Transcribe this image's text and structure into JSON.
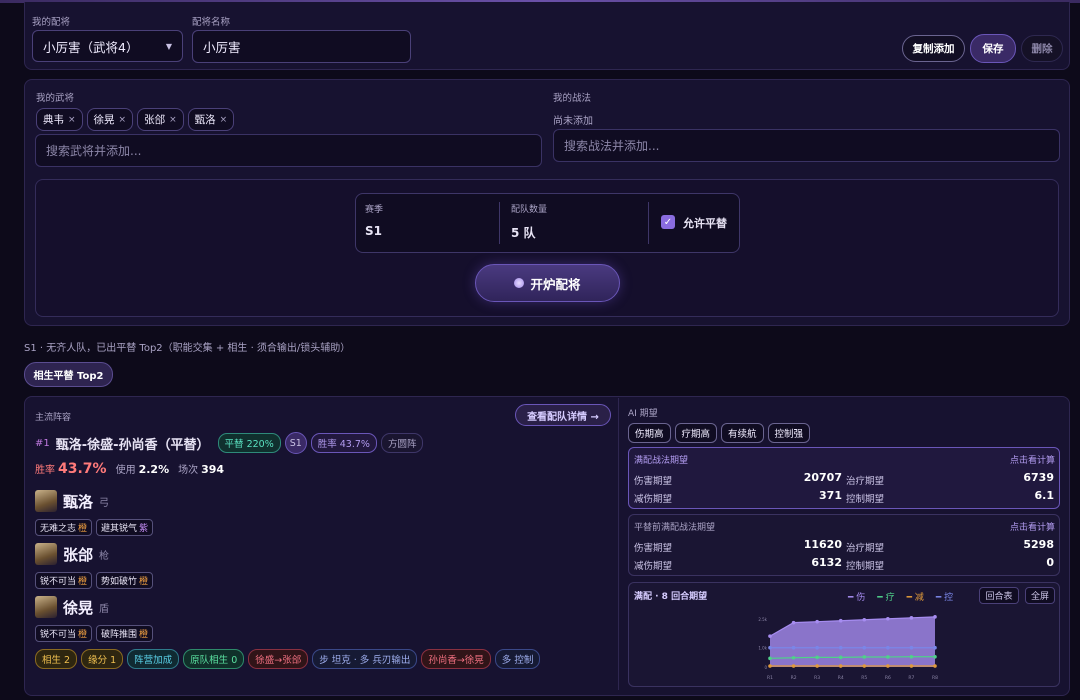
{
  "config": {
    "my_config_label": "我的配将",
    "my_config_value": "小厉害（武将4）",
    "name_label": "配将名称",
    "name_value": "小厉害",
    "copy_btn": "复制添加",
    "save_btn": "保存",
    "delete_btn": "删除"
  },
  "heroes": {
    "label": "我的武将",
    "chips": [
      "典韦",
      "徐晃",
      "张郃",
      "甄洛"
    ],
    "placeholder": "搜索武将并添加..."
  },
  "tactics": {
    "label": "我的战法",
    "empty": "尚未添加",
    "placeholder": "搜索战法并添加..."
  },
  "options": {
    "season_label": "赛季",
    "season_value": "S1",
    "team_label": "配队数量",
    "team_value": "5 队",
    "allow_sub_label": "允许平替",
    "forge_btn": "开炉配将"
  },
  "summary": "S1 · 无齐人队，已出平替 Top2（职能交集 + 相生 · 须合输出/锁头辅助）",
  "tab_label": "相生平替 Top2",
  "lineup": {
    "section_label": "主流阵容",
    "detail_btn": "查看配队详情 →",
    "rank": "#1",
    "title": "甄洛-徐盛-孙尚香（平替）",
    "sub_badge": "平替 220%",
    "season_badge": "S1",
    "winrate_badge": "胜率 43.7%",
    "formation_badge": "方圆阵",
    "winrate_label": "胜率",
    "winrate_value": "43.7%",
    "usage_label": "使用",
    "usage_value": "2.2%",
    "games_label": "场次",
    "games_value": "394",
    "generals": [
      {
        "name": "甄洛",
        "type": "弓",
        "skills": [
          {
            "name": "无难之志",
            "grade": "橙"
          },
          {
            "name": "避其锐气",
            "grade": "紫"
          }
        ]
      },
      {
        "name": "张郃",
        "type": "枪",
        "skills": [
          {
            "name": "锐不可当",
            "grade": "橙"
          },
          {
            "name": "势如破竹",
            "grade": "橙"
          }
        ]
      },
      {
        "name": "徐晃",
        "type": "盾",
        "skills": [
          {
            "name": "锐不可当",
            "grade": "橙"
          },
          {
            "name": "破阵推围",
            "grade": "橙"
          }
        ]
      }
    ],
    "tags": [
      "相生 2",
      "缘分 1",
      "阵营加成",
      "原队相生 0",
      "徐盛→张郃",
      "步 坦克 · 多 兵刃输出",
      "孙尚香→徐晃",
      "多 控制"
    ]
  },
  "ai": {
    "label": "AI 期望",
    "chips": [
      "伤期高",
      "疗期高",
      "有续航",
      "控制强"
    ],
    "full": {
      "title": "满配战法期望",
      "link": "点击看计算",
      "dmg_label": "伤害期望",
      "dmg": "20707",
      "heal_label": "治疗期望",
      "heal": "6739",
      "red_label": "减伤期望",
      "red": "371",
      "ctrl_label": "控制期望",
      "ctrl": "6.1"
    },
    "sub": {
      "title": "平替前满配战法期望",
      "link": "点击看计算",
      "dmg_label": "伤害期望",
      "dmg": "11620",
      "heal_label": "治疗期望",
      "heal": "5298",
      "red_label": "减伤期望",
      "red": "6132",
      "ctrl_label": "控制期望",
      "ctrl": "0"
    },
    "chart_title": "满配 · 8 回合期望",
    "legend": [
      "伤",
      "疗",
      "减",
      "控"
    ],
    "table_btn": "回合表",
    "full_btn": "全屏"
  },
  "colors": {
    "dmg": "#a68cf0",
    "heal": "#4fd08a",
    "red": "#e09a3a",
    "ctrl": "#7a86e8"
  },
  "chart_data": {
    "type": "line",
    "x": [
      "R1",
      "R2",
      "R3",
      "R4",
      "R5",
      "R6",
      "R7",
      "R8"
    ],
    "ytick_labels": [
      "2.5k",
      "1.0k",
      "0"
    ],
    "series": [
      {
        "name": "伤",
        "values": [
          1.6,
          2.3,
          2.35,
          2.4,
          2.45,
          2.5,
          2.55,
          2.6
        ]
      },
      {
        "name": "疗",
        "values": [
          0.45,
          0.48,
          0.5,
          0.5,
          0.52,
          0.52,
          0.53,
          0.53
        ]
      },
      {
        "name": "减",
        "values": [
          0.05,
          0.05,
          0.05,
          0.05,
          0.05,
          0.05,
          0.05,
          0.05
        ]
      },
      {
        "name": "控",
        "values": [
          1.0,
          1.0,
          1.0,
          1.0,
          1.0,
          1.0,
          1.0,
          1.0
        ]
      }
    ],
    "ylim": [
      0,
      2.8
    ]
  }
}
